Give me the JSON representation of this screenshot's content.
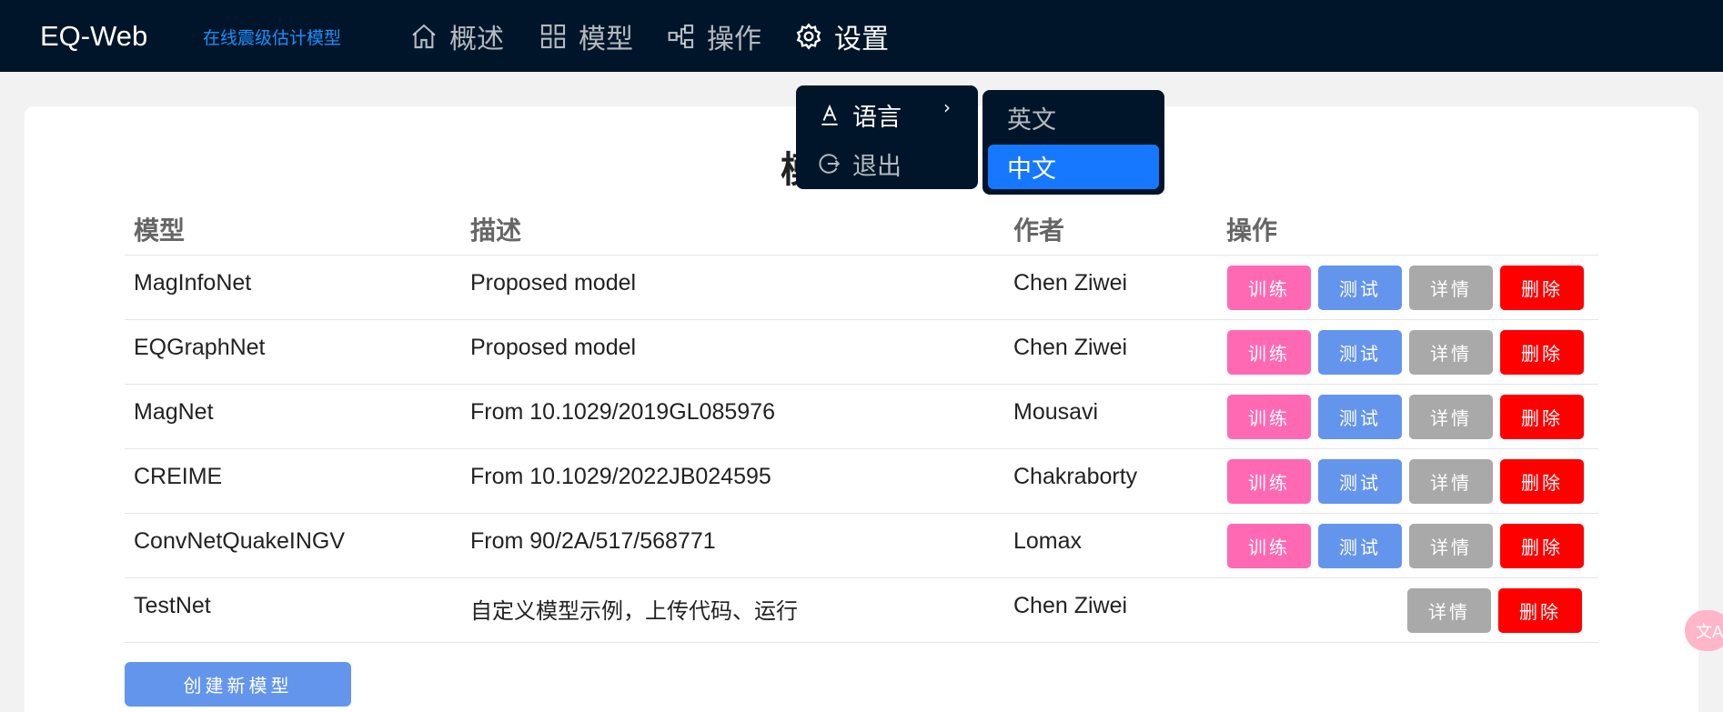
{
  "app": {
    "brand": "EQ-Web",
    "tagline": "在线震级估计模型"
  },
  "nav": [
    {
      "label": "概述",
      "icon": "home-icon"
    },
    {
      "label": "模型",
      "icon": "grid-icon"
    },
    {
      "label": "操作",
      "icon": "network-icon"
    },
    {
      "label": "设置",
      "icon": "gear-icon"
    }
  ],
  "page": {
    "title_partial": "模"
  },
  "table": {
    "headers": [
      "模型",
      "描述",
      "作者",
      "操作"
    ],
    "rows": [
      {
        "model": "MagInfoNet",
        "desc": "Proposed model",
        "author": "Chen Ziwei"
      },
      {
        "model": "EQGraphNet",
        "desc": "Proposed model",
        "author": "Chen Ziwei"
      },
      {
        "model": "MagNet",
        "desc": "From 10.1029/2019GL085976",
        "author": "Mousavi"
      },
      {
        "model": "CREIME",
        "desc": "From 10.1029/2022JB024595",
        "author": "Chakraborty"
      },
      {
        "model": "ConvNetQuakeINGV",
        "desc": "From 90/2A/517/568771",
        "author": "Lomax"
      },
      {
        "model": "TestNet",
        "desc": "自定义模型示例，上传代码、运行",
        "author": "Chen Ziwei"
      }
    ],
    "actions": {
      "train": "训练",
      "test": "测试",
      "detail": "详情",
      "delete": "删除"
    }
  },
  "create_button": "创建新模型",
  "settings_menu": {
    "items": [
      {
        "label": "语言",
        "icon": "font-icon"
      },
      {
        "label": "退出",
        "icon": "logout-icon"
      }
    ],
    "arrow": "›"
  },
  "language_submenu": {
    "options": [
      "英文",
      "中文"
    ],
    "selected": "中文"
  },
  "translate_widget": {
    "icon": "translate-icon",
    "glyph": "文A"
  },
  "colors": {
    "header_bg": "#001529",
    "accent": "#1890ff",
    "train": "#ff69b4",
    "test": "#6495ed",
    "detail": "#a9a9a9",
    "delete": "#ff0000",
    "selected": "#1677ff"
  }
}
